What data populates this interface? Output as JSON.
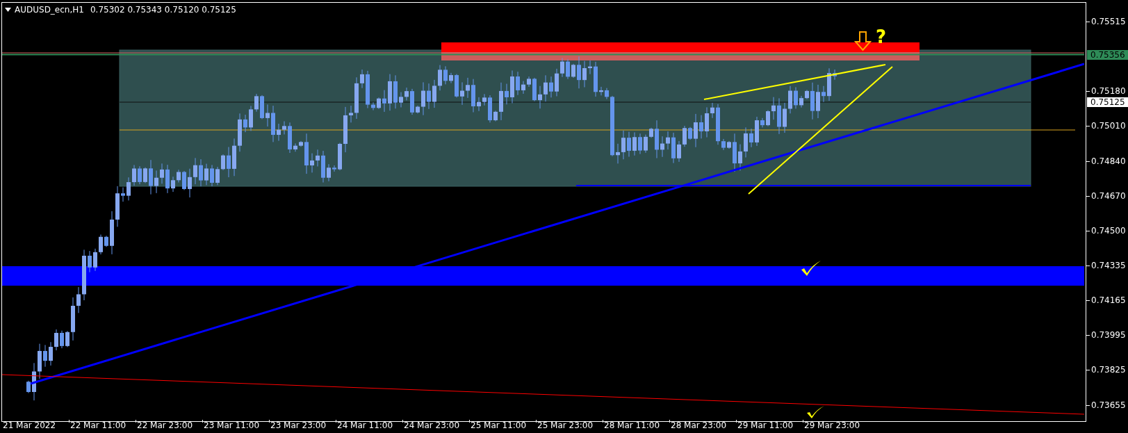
{
  "header": {
    "symbol": "AUDUSD_ecn,H1",
    "ohlc": "0.75302 0.75343 0.75120 0.75125"
  },
  "annotation_text": "?",
  "price_axis": [
    "0.75515",
    "0.75180",
    "0.75010",
    "0.74840",
    "0.74670",
    "0.74500",
    "0.74335",
    "0.74165",
    "0.73995",
    "0.73825",
    "0.73655"
  ],
  "price_markers": [
    {
      "kind": "level",
      "label": "0.75356"
    },
    {
      "kind": "bid",
      "label": "0.75125"
    }
  ],
  "time_axis": [
    "21 Mar 2022",
    "22 Mar 11:00",
    "22 Mar 23:00",
    "23 Mar 11:00",
    "23 Mar 23:00",
    "24 Mar 11:00",
    "24 Mar 23:00",
    "25 Mar 11:00",
    "25 Mar 23:00",
    "28 Mar 11:00",
    "28 Mar 23:00",
    "29 Mar 11:00",
    "29 Mar 23:00"
  ]
}
